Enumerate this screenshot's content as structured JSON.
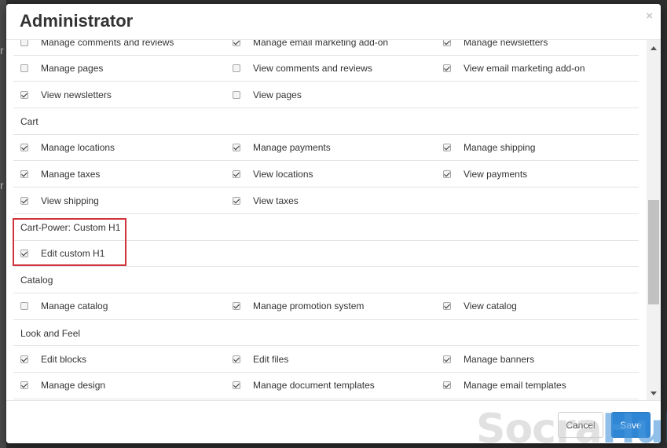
{
  "modal": {
    "title": "Administrator",
    "close_symbol": "×",
    "cancel_label": "Cancel",
    "save_label": "Save"
  },
  "watermark": {
    "part1": "Socra",
    "part2": "Hub"
  },
  "backdrop": {
    "glyphs": [
      "r",
      "r"
    ]
  },
  "sections": [
    {
      "name": "",
      "rows": [
        [
          {
            "label": "Manage comments and reviews",
            "checked": false
          },
          {
            "label": "Manage email marketing add-on",
            "checked": true
          },
          {
            "label": "Manage newsletters",
            "checked": true
          }
        ],
        [
          {
            "label": "Manage pages",
            "checked": false
          },
          {
            "label": "View comments and reviews",
            "checked": false
          },
          {
            "label": "View email marketing add-on",
            "checked": true
          }
        ],
        [
          {
            "label": "View newsletters",
            "checked": true
          },
          {
            "label": "View pages",
            "checked": false
          }
        ]
      ]
    },
    {
      "name": "Cart",
      "rows": [
        [
          {
            "label": "Manage locations",
            "checked": true
          },
          {
            "label": "Manage payments",
            "checked": true
          },
          {
            "label": "Manage shipping",
            "checked": true
          }
        ],
        [
          {
            "label": "Manage taxes",
            "checked": true
          },
          {
            "label": "View locations",
            "checked": true
          },
          {
            "label": "View payments",
            "checked": true
          }
        ],
        [
          {
            "label": "View shipping",
            "checked": true
          },
          {
            "label": "View taxes",
            "checked": true
          }
        ]
      ]
    },
    {
      "name": "Cart-Power: Custom H1",
      "rows": [
        [
          {
            "label": "Edit custom H1",
            "checked": true
          }
        ]
      ]
    },
    {
      "name": "Catalog",
      "rows": [
        [
          {
            "label": "Manage catalog",
            "checked": false
          },
          {
            "label": "Manage promotion system",
            "checked": true
          },
          {
            "label": "View catalog",
            "checked": true
          }
        ]
      ]
    },
    {
      "name": "Look and Feel",
      "rows": [
        [
          {
            "label": "Edit blocks",
            "checked": true
          },
          {
            "label": "Edit files",
            "checked": true
          },
          {
            "label": "Manage banners",
            "checked": true
          }
        ],
        [
          {
            "label": "Manage design",
            "checked": true
          },
          {
            "label": "Manage document templates",
            "checked": true
          },
          {
            "label": "Manage email templates",
            "checked": true
          }
        ]
      ]
    }
  ],
  "colors": {
    "highlight": "#d0333b",
    "primary": "#2f86d4"
  }
}
